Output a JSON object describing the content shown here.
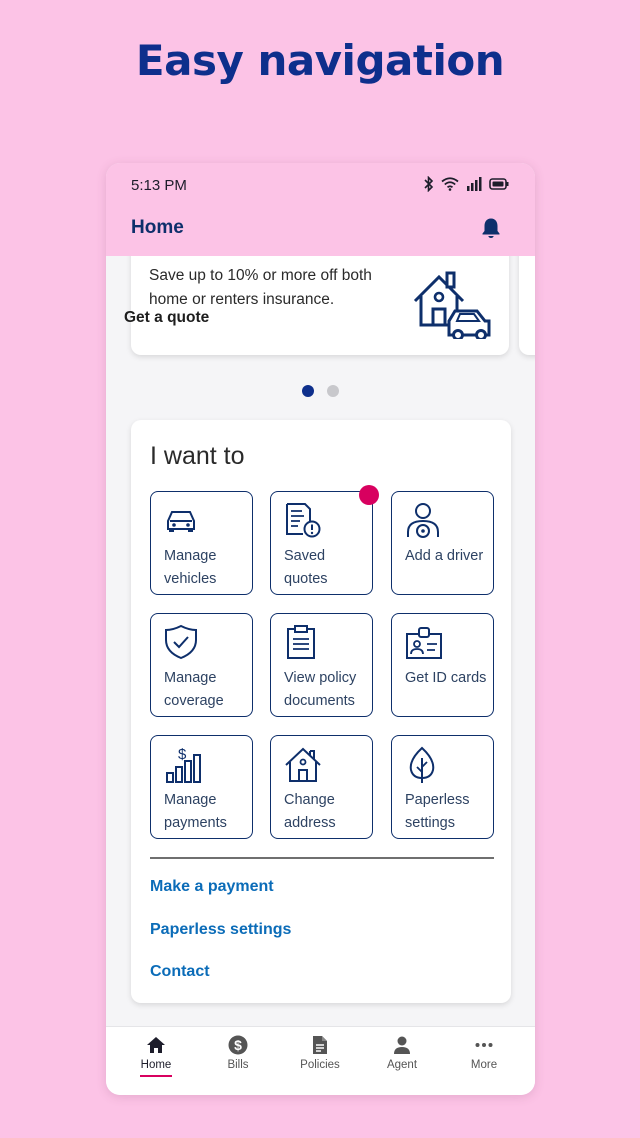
{
  "headline": "Easy navigation",
  "status": {
    "time": "5:13 PM"
  },
  "appbar": {
    "title": "Home"
  },
  "promo": {
    "text": "Save up to 10% or more off both home or renters insurance.",
    "link": "Get a quote"
  },
  "carousel": {
    "pages": 2,
    "active": 1
  },
  "iwant": {
    "title": "I want to",
    "tiles": [
      {
        "label": "Manage vehicles",
        "icon": "car-icon"
      },
      {
        "label": "Saved quotes",
        "icon": "quote-alert-icon"
      },
      {
        "label": "Add a driver",
        "icon": "driver-icon"
      },
      {
        "label": "Manage coverage",
        "icon": "shield-check-icon"
      },
      {
        "label": "View policy documents",
        "icon": "clipboard-icon"
      },
      {
        "label": "Get ID cards",
        "icon": "id-card-icon"
      },
      {
        "label": "Manage payments",
        "icon": "dollar-chart-icon"
      },
      {
        "label": "Change address",
        "icon": "house-icon"
      },
      {
        "label": "Paperless settings",
        "icon": "leaf-icon"
      }
    ],
    "links": [
      "Make a payment",
      "Paperless settings",
      "Contact"
    ]
  },
  "nav": [
    {
      "label": "Home",
      "icon": "home-icon",
      "active": true
    },
    {
      "label": "Bills",
      "icon": "dollar-circle-icon"
    },
    {
      "label": "Policies",
      "icon": "document-icon"
    },
    {
      "label": "Agent",
      "icon": "person-icon"
    },
    {
      "label": "More",
      "icon": "more-dots-icon"
    }
  ],
  "colors": {
    "background": "#fcc3e6",
    "navy": "#0e2f6b",
    "link": "#0b6cb8",
    "badge": "#d8005f"
  }
}
